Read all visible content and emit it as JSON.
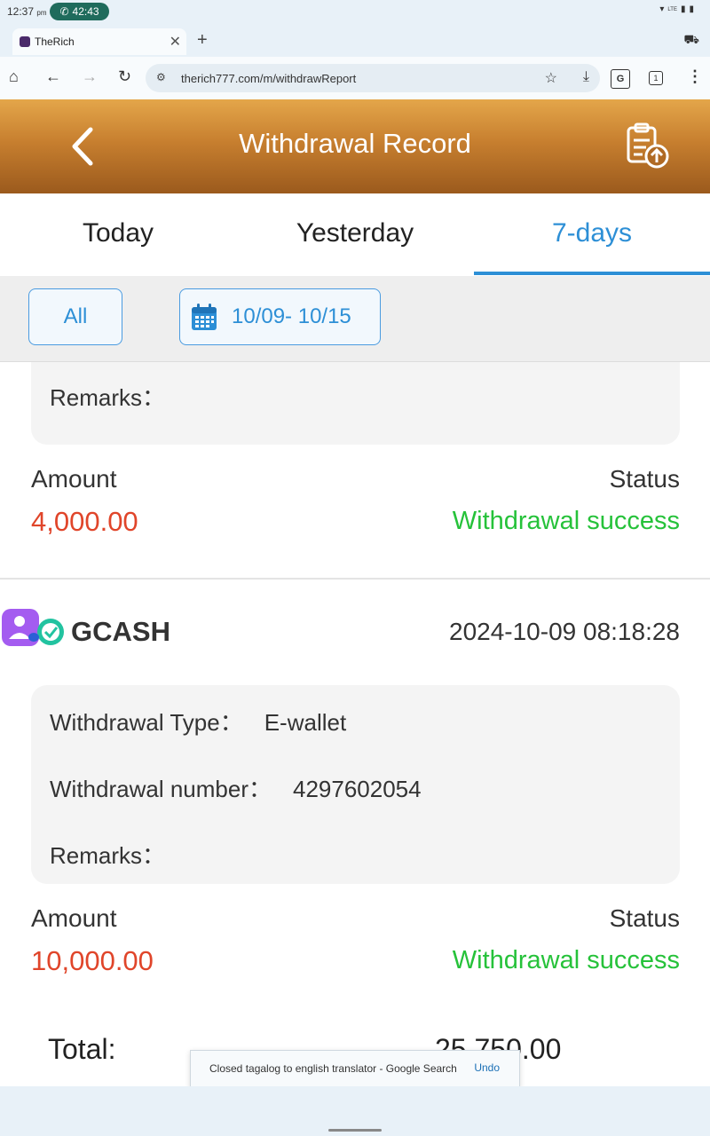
{
  "status_bar": {
    "time": "12:37",
    "time_suffix": "pm",
    "call_timer": "42:43",
    "network": "LTE"
  },
  "browser": {
    "tab_title": "TheRich",
    "url": "therich777.com/m/withdrawReport",
    "tab_count": "1"
  },
  "header": {
    "title": "Withdrawal Record"
  },
  "date_tabs": [
    {
      "label": "Today",
      "active": false
    },
    {
      "label": "Yesterday",
      "active": false
    },
    {
      "label": "7-days",
      "active": true
    }
  ],
  "filters": {
    "type_label": "All",
    "date_range": "10/09- 10/15"
  },
  "labels": {
    "withdrawal_type": "Withdrawal Type：",
    "withdrawal_number": "Withdrawal number：",
    "remarks": "Remarks：",
    "amount": "Amount",
    "status": "Status",
    "total": "Total:"
  },
  "records": [
    {
      "amount": "4,000.00",
      "status": "Withdrawal success"
    },
    {
      "method": "GCASH",
      "datetime": "2024-10-09 08:18:28",
      "withdrawal_type": "E-wallet",
      "withdrawal_number": "4297602054",
      "amount": "10,000.00",
      "status": "Withdrawal success"
    }
  ],
  "total": "25,750.00",
  "snackbar": {
    "message": "Closed tagalog to english translator - Google Search",
    "action": "Undo"
  },
  "colors": {
    "header_gradient_top": "#e4a64a",
    "header_gradient_bottom": "#9b5a1d",
    "accent_blue": "#2d8fd6",
    "amount_red": "#e0452a",
    "success_green": "#26c23a"
  }
}
